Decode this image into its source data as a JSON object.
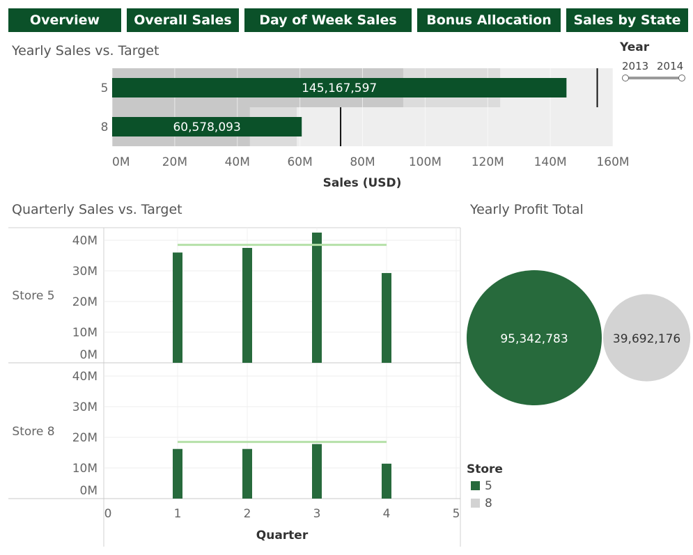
{
  "nav": {
    "overview": "Overview",
    "overall_sales": "Overall Sales",
    "day_of_week_sales": "Day of Week Sales",
    "bonus_allocation": "Bonus Allocation",
    "sales_by_state": "Sales by State"
  },
  "filter": {
    "title": "Year",
    "min_label": "2013",
    "max_label": "2014"
  },
  "legend": {
    "title": "Store",
    "items": [
      {
        "label": "5",
        "color": "#276a3c"
      },
      {
        "label": "8",
        "color": "#d3d3d3"
      }
    ]
  },
  "colors": {
    "nav_bg": "#0b5129",
    "bar_dark": "#0b5129",
    "bar_column": "#276a3c",
    "target_line": "#b5e0a8",
    "band_dark": "#c8c8c8",
    "band_mid": "#dcdcdc",
    "band_light": "#eeeeee",
    "bubble_8": "#d3d3d3"
  },
  "chart_data": [
    {
      "type": "bar",
      "title": "Yearly Sales vs. Target",
      "xlabel": "Sales (USD)",
      "ylabel": "",
      "xlim": [
        0,
        160000000
      ],
      "x_ticks": [
        "0M",
        "20M",
        "40M",
        "60M",
        "80M",
        "100M",
        "120M",
        "140M",
        "160M"
      ],
      "categories": [
        "5",
        "8"
      ],
      "values": [
        145167597,
        60578093
      ],
      "value_labels": [
        "145,167,597",
        "60,578,093"
      ],
      "targets": [
        155000000,
        73000000
      ],
      "bands": [
        {
          "category": "5",
          "dark": 93000000,
          "mid": 124000000
        },
        {
          "category": "8",
          "dark": 44000000,
          "mid": 59000000
        }
      ]
    },
    {
      "type": "bar",
      "title": "Quarterly Sales vs. Target",
      "xlabel": "Quarter",
      "x_ticks": [
        "0",
        "1",
        "2",
        "3",
        "4",
        "5"
      ],
      "xlim": [
        0,
        5
      ],
      "y_ticks": [
        "0M",
        "10M",
        "20M",
        "30M",
        "40M"
      ],
      "ylim": [
        0,
        45000000
      ],
      "panels": [
        {
          "label": "Store 5",
          "quarters": [
            1,
            2,
            3,
            4
          ],
          "values": [
            36000000,
            37500000,
            42500000,
            29300000
          ],
          "target": 38500000
        },
        {
          "label": "Store 8",
          "quarters": [
            1,
            2,
            3,
            4
          ],
          "values": [
            16200000,
            16200000,
            17800000,
            11400000
          ],
          "target": 18500000
        }
      ]
    },
    {
      "type": "bubble",
      "title": "Yearly Profit Total",
      "categories": [
        "5",
        "8"
      ],
      "values": [
        95342783,
        39692176
      ],
      "value_labels": [
        "95,342,783",
        "39,692,176"
      ]
    }
  ]
}
